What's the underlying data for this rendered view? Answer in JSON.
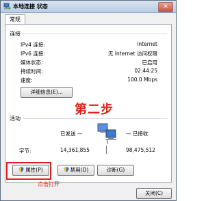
{
  "window": {
    "title": "本地连接 状态",
    "close_glyph": "✕"
  },
  "tabs": [
    {
      "label": "常规"
    }
  ],
  "connection": {
    "section_title": "连接",
    "rows": [
      {
        "label": "IPv4 连接:",
        "value": "Internet"
      },
      {
        "label": "IPv6 连接:",
        "value": "无 Internet 访问权限"
      },
      {
        "label": "媒体状态:",
        "value": "已启用"
      },
      {
        "label": "持续时间:",
        "value": "02:44:25"
      },
      {
        "label": "速度:",
        "value": "100.0 Mbps"
      }
    ],
    "details_button": "详细信息(E)..."
  },
  "activity": {
    "section_title": "活动",
    "sent_label": "已发送 —",
    "received_label": "— 已接收",
    "bytes_label": "字节:",
    "bytes_sent": "14,361,855",
    "bytes_received": "98,475,512"
  },
  "buttons": {
    "properties": "属性(P)",
    "disable": "禁用(D)",
    "diagnose": "诊断(G)",
    "close": "关闭(C)"
  },
  "annotations": {
    "step": "第二步",
    "hint": "点击打开"
  },
  "colors": {
    "annotation_red": "#e0201a",
    "title_gradient_top": "#d7e3f1",
    "title_gradient_bottom": "#b9cde6"
  },
  "icons": {
    "title": "network-connection-icon",
    "activity": "network-computers-icon",
    "shield": "uac-shield-icon"
  }
}
